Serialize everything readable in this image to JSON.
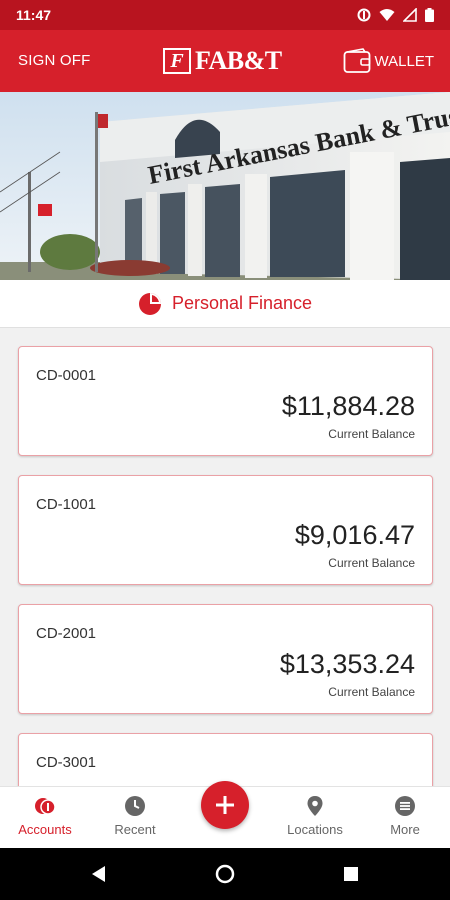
{
  "status_bar": {
    "time": "11:47"
  },
  "header": {
    "sign_off_label": "SIGN OFF",
    "logo_mark": "F",
    "logo_text": "FAB&T",
    "wallet_label": "WALLET"
  },
  "banner": {
    "building_sign": "First Arkansas Bank & Trust"
  },
  "section": {
    "title": "Personal Finance",
    "icon": "pie-chart-icon"
  },
  "accounts": [
    {
      "name": "CD-0001",
      "balance": "$11,884.28",
      "balance_label": "Current Balance"
    },
    {
      "name": "CD-1001",
      "balance": "$9,016.47",
      "balance_label": "Current Balance"
    },
    {
      "name": "CD-2001",
      "balance": "$13,353.24",
      "balance_label": "Current Balance"
    },
    {
      "name": "CD-3001"
    }
  ],
  "bottom_nav": {
    "items": [
      {
        "label": "Accounts",
        "icon": "accounts-icon",
        "active": true
      },
      {
        "label": "Recent",
        "icon": "clock-icon"
      },
      {
        "label": "Locations",
        "icon": "location-pin-icon"
      },
      {
        "label": "More",
        "icon": "menu-icon"
      }
    ],
    "fab_icon": "plus-icon"
  },
  "colors": {
    "brand_red": "#d6202b",
    "status_bar_red": "#b8141f",
    "card_border": "#eaa1a6"
  }
}
